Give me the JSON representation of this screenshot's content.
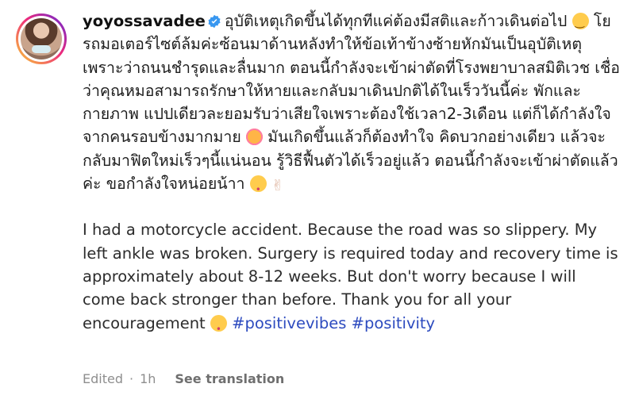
{
  "post": {
    "username": "yoyossavadee",
    "thai_part1": "อุบัติเหตุเกิดขึ้นได้ทุกทีแค่ต้องมีสติและก้าวเดินต่อไป",
    "thai_part2": "โยรถมอเตอร์ไซต์ล้มค่ะซ้อนมาด้านหลังทำให้ข้อเท้าข้างซ้ายหักมันเป็นอุบัติเหตุเพราะว่าถนนชำรุดและลื่นมาก ตอนนี้กำลังจะเข้าผ่าตัดที่โรงพยาบาลสมิติเวช เชื่อว่าคุณหมอสามารถรักษาให้หายและกลับมาเดินปกติได้ในเร็ววันนี้ค่ะ พักและกายภาพ แปปเดียวละยอมรับว่าเสียใจเพราะต้องใช้เวลา2-3เดือน แต่ก็ได้กำลังใจจากคนรอบข้างมากมาย",
    "thai_part3": "มันเกิดขึ้นแล้วก็ต้องทำใจ คิดบวกอย่างเดียว แล้วจะกลับมาฟิตใหม่เร็วๆนี้แน่นอน รู้วิธีฟื้นตัวได้เร็วอยู่แล้ว ตอนนี้กำลังจะเข้าผ่าตัดแล้วค่ะ ขอกำลังใจหน่อยน้าา",
    "english_text": "I had a motorcycle accident. Because the road was so slippery. My left ankle was broken. Surgery is required today and recovery time is approximately about 8-12 weeks. But don't worry because I will come back stronger than before. Thank you for all your encouragement",
    "hashtag1": "#positivevibes",
    "hashtag2": "#positivity"
  },
  "meta": {
    "edited": "Edited",
    "separator": "·",
    "time": "1h",
    "see_translation": "See translation"
  },
  "icons": {
    "verified": "verified-badge-icon",
    "emoji_smile": "smiling-face-emoji",
    "emoji_blush": "smiling-face-with-hearts-emoji",
    "emoji_kiss": "kissing-face-emoji",
    "emoji_peace": "victory-hand-emoji"
  },
  "colors": {
    "verified_blue": "#3897f0",
    "hashtag": "#2d4bbf",
    "meta_gray": "#8e8e8e"
  }
}
